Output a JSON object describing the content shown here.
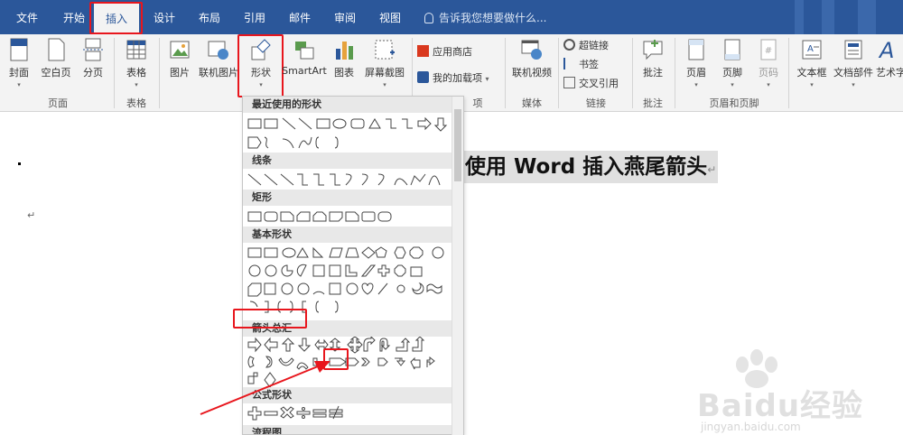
{
  "window": {
    "tell_me": "告诉我您想要做什么..."
  },
  "tabs": [
    "文件",
    "开始",
    "插入",
    "设计",
    "布局",
    "引用",
    "邮件",
    "审阅",
    "视图"
  ],
  "active_tab": "插入",
  "ribbon": {
    "pages": {
      "cover": "封面",
      "blank": "空白页",
      "break": "分页",
      "group": "页面"
    },
    "tables": {
      "table": "表格",
      "group": "表格"
    },
    "illustrations": {
      "picture": "图片",
      "online_picture": "联机图片",
      "shapes": "形状",
      "smartart": "SmartArt",
      "chart": "图表",
      "screenshot": "屏幕截图"
    },
    "addins": {
      "store": "应用商店",
      "my_addins": "我的加载项",
      "group": "项"
    },
    "media": {
      "online_video": "联机视频",
      "group": "媒体"
    },
    "links": {
      "hyperlink": "超链接",
      "bookmark": "书签",
      "cross_ref": "交叉引用",
      "group": "链接"
    },
    "comments": {
      "comment": "批注",
      "group": "批注"
    },
    "header_footer": {
      "header": "页眉",
      "footer": "页脚",
      "page_number": "页码",
      "group": "页眉和页脚"
    },
    "text": {
      "textbox": "文本框",
      "quick_parts": "文档部件",
      "wordart": "艺术字"
    }
  },
  "document": {
    "heading": "使用 Word 插入燕尾箭头",
    "para_mark": "↵"
  },
  "shapes_menu": {
    "sections": [
      {
        "title": "最近使用的形状",
        "rows": 2
      },
      {
        "title": "线条",
        "rows": 1
      },
      {
        "title": "矩形",
        "rows": 1
      },
      {
        "title": "基本形状",
        "rows": 4
      },
      {
        "title": "箭头总汇",
        "rows": 3
      },
      {
        "title": "公式形状",
        "rows": 1
      },
      {
        "title": "流程图",
        "rows": 0
      }
    ]
  },
  "watermark": {
    "brand": "Baidu经验",
    "url": "jingyan.baidu.com"
  },
  "colors": {
    "tabbar": "#2b579a",
    "highlight": "#e8161d",
    "ribbon": "#f3f3f3"
  }
}
